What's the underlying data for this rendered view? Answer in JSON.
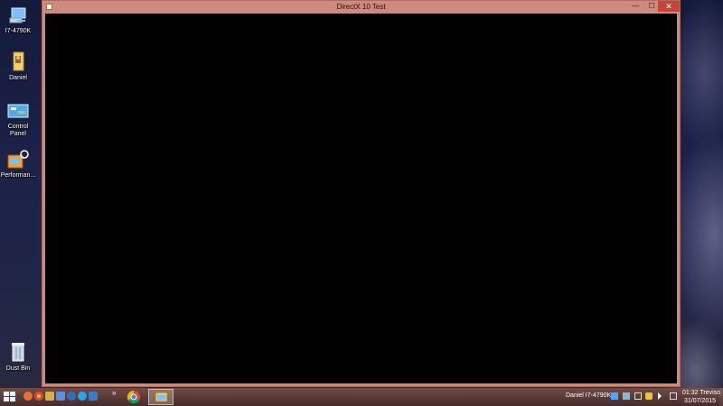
{
  "desktop": {
    "icons": [
      {
        "label": "I7-4790K",
        "icon": "computer-icon"
      },
      {
        "label": "Daniel",
        "icon": "user-folder-icon"
      },
      {
        "label": "Control Panel",
        "icon": "control-panel-icon"
      },
      {
        "label": "Performan...",
        "icon": "performance-icon"
      },
      {
        "label": "Dust Bin",
        "icon": "recycle-bin-icon"
      }
    ]
  },
  "window": {
    "title": "DirectX 10 Test",
    "minimize_glyph": "—",
    "maximize_glyph": "☐",
    "close_glyph": "✕"
  },
  "taskbar": {
    "overflow_glyph": "»",
    "user_label": "Daniel I7-4790K",
    "clock_time": "01:32 Treviso",
    "clock_date": "31/07/2015",
    "quick_launch": [
      "firefox-icon",
      "chrome-icon",
      "paint-icon",
      "mail-icon",
      "steam-icon",
      "skype-icon",
      "app-icon"
    ],
    "pinned": [
      "chrome-icon",
      "file-explorer-icon"
    ],
    "tray": [
      "network-status-icon",
      "network-icon",
      "display-icon",
      "shield-icon",
      "volume-icon",
      "connection-icon"
    ]
  }
}
